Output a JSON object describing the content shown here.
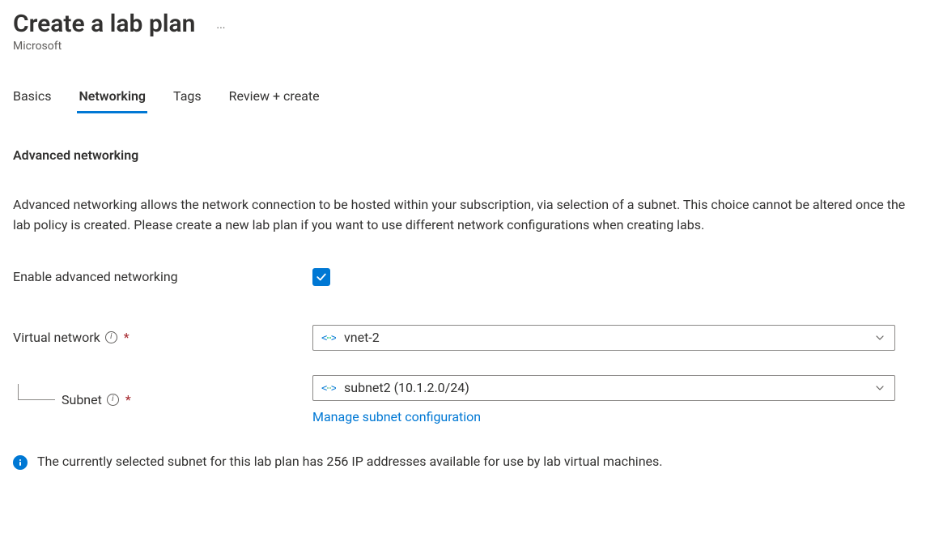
{
  "header": {
    "title": "Create a lab plan",
    "subtitle": "Microsoft",
    "more_label": "···"
  },
  "tabs": [
    {
      "label": "Basics",
      "active": false
    },
    {
      "label": "Networking",
      "active": true
    },
    {
      "label": "Tags",
      "active": false
    },
    {
      "label": "Review + create",
      "active": false
    }
  ],
  "section": {
    "heading": "Advanced networking",
    "description": "Advanced networking allows the network connection to be hosted within your subscription, via selection of a subnet. This choice cannot be altered once the lab policy is created. Please create a new lab plan if you want to use different network configurations when creating labs."
  },
  "form": {
    "enable_label": "Enable advanced networking",
    "enable_checked": true,
    "vnet_label": "Virtual network",
    "vnet_value": "vnet-2",
    "subnet_label": "Subnet",
    "subnet_value": "subnet2 (10.1.2.0/24)",
    "manage_link": "Manage subnet configuration"
  },
  "info": "The currently selected subnet for this lab plan has 256 IP addresses available for use by lab virtual machines."
}
